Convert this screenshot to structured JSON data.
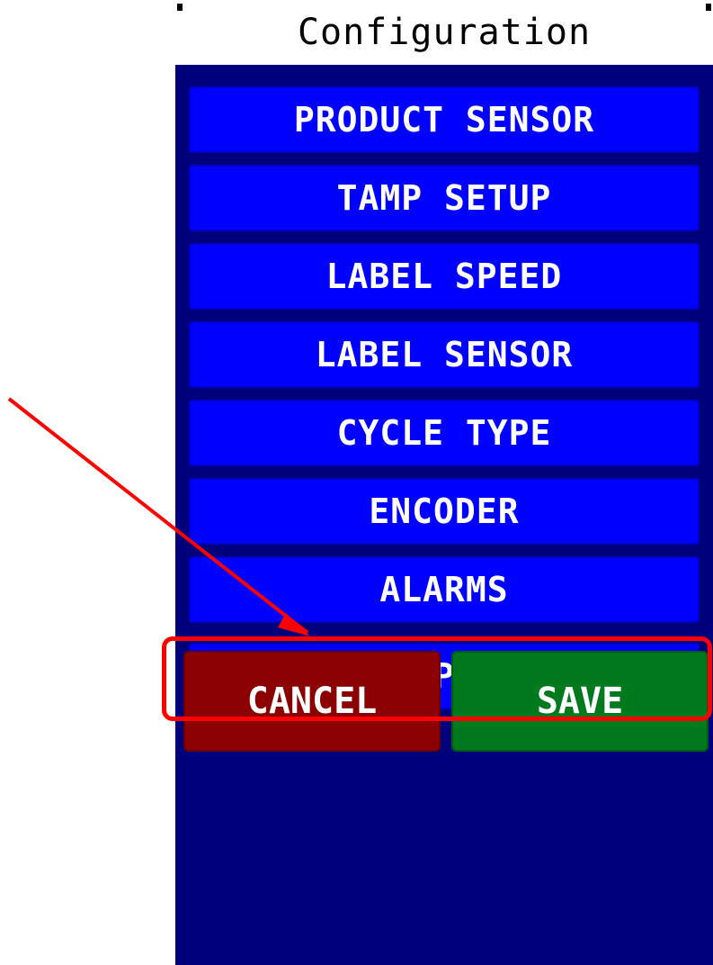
{
  "screen": {
    "title": "Configuration",
    "menu_items": [
      {
        "label": "PRODUCT SENSOR"
      },
      {
        "label": "TAMP SETUP"
      },
      {
        "label": "LABEL SPEED"
      },
      {
        "label": "LABEL SENSOR"
      },
      {
        "label": "CYCLE TYPE"
      },
      {
        "label": "ENCODER"
      },
      {
        "label": "ALARMS"
      },
      {
        "label": "ENABLE PASSWORD"
      }
    ],
    "cancel_label": "CANCEL",
    "save_label": "SAVE"
  },
  "annotation": {
    "target": "ENABLE PASSWORD",
    "color": "#ff0000"
  },
  "colors": {
    "panel_background": "#00007a",
    "menu_button": "#0000ff",
    "cancel_button": "#8b0000",
    "save_button": "#007a1c"
  }
}
